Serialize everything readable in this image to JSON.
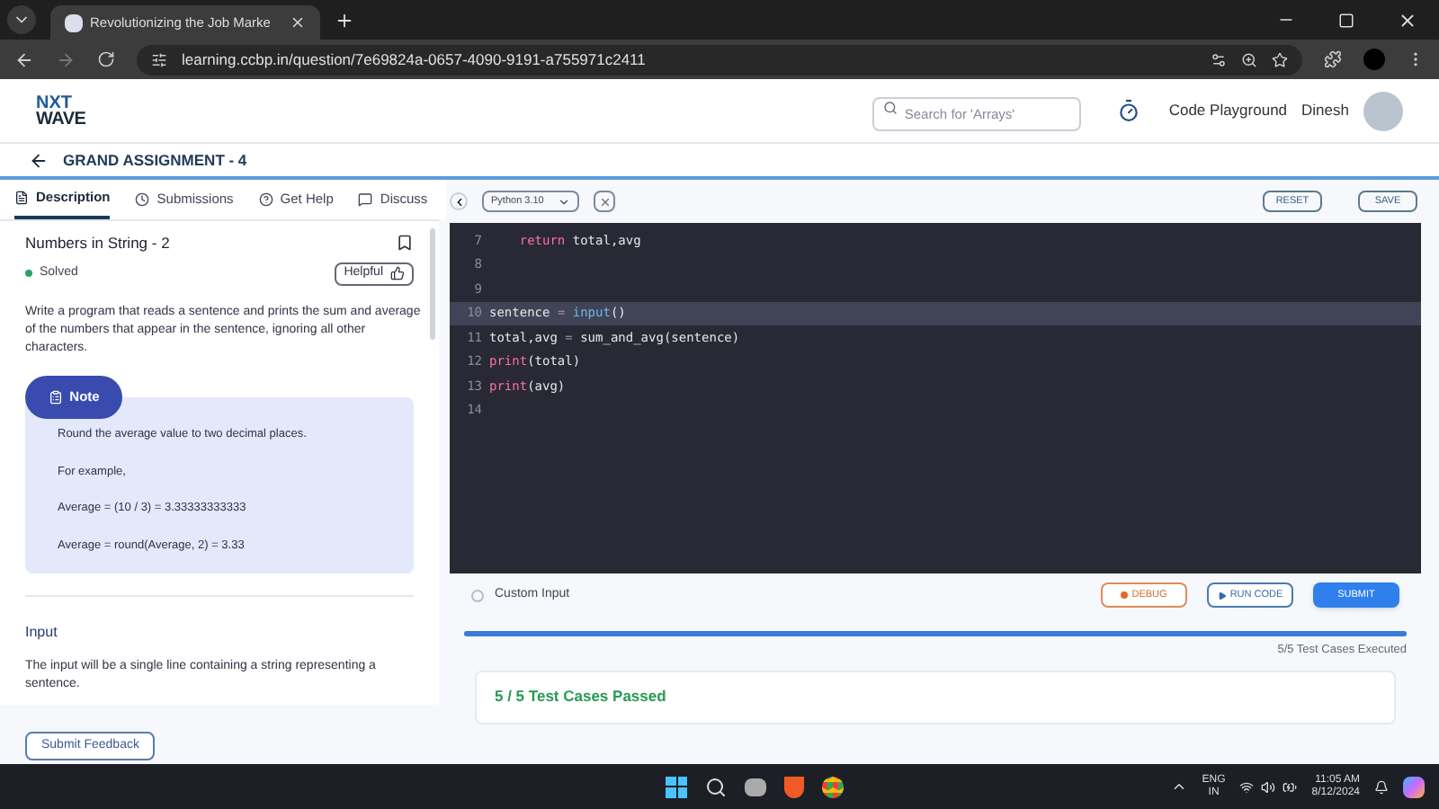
{
  "browser": {
    "tab_title": "Revolutionizing the Job Marke",
    "url": "learning.ccbp.in/question/7e69824a-0657-4090-9191-a755971c2411"
  },
  "header": {
    "logo_top": "NXT",
    "logo_bottom": "WAVE",
    "search": {
      "placeholder": "Search for 'Arrays'"
    },
    "links": [
      "Code Playground",
      "Dinesh"
    ]
  },
  "page_title": "GRAND ASSIGNMENT - 4",
  "tabs": [
    {
      "label": "Description",
      "selected": true
    },
    {
      "label": "Submissions",
      "selected": false
    },
    {
      "label": "Get Help",
      "selected": false
    },
    {
      "label": "Discuss",
      "selected": false
    }
  ],
  "question": {
    "title": "Numbers in String - 2",
    "status": "Solved",
    "helpful": "Helpful",
    "body": "Write a program that reads a sentence and prints the sum and average of the numbers that appear in the sentence, ignoring all other characters.",
    "note": {
      "label": "Note",
      "lines": [
        "Round the average value to two decimal places.",
        "For example,",
        "Average = (10 / 3) = 3.33333333333",
        "Average = round(Average, 2) = 3.33"
      ]
    },
    "input_heading": "Input",
    "input_text": "The input will be a single line containing a string representing a sentence."
  },
  "feedback_button": "Submit Feedback",
  "editor": {
    "language": "Python 3.10",
    "buttons": [
      "RESET",
      "SAVE"
    ],
    "lines": [
      {
        "number": "7",
        "highlighted": false,
        "tokens": [
          {
            "text": "    return",
            "kind": "keyword"
          },
          {
            "text": " total,avg",
            "kind": "plain"
          }
        ]
      },
      {
        "number": "8",
        "highlighted": false
      },
      {
        "number": "9",
        "highlighted": false
      },
      {
        "number": "10",
        "highlighted": true,
        "tokens": [
          {
            "text": "sentence ",
            "kind": "plain"
          },
          {
            "text": "= ",
            "kind": "operator"
          },
          {
            "text": "input",
            "kind": "builtin"
          },
          {
            "text": "()",
            "kind": "plain"
          }
        ]
      },
      {
        "number": "11",
        "highlighted": false,
        "tokens": [
          {
            "text": "total,avg ",
            "kind": "plain"
          },
          {
            "text": "=",
            "kind": "operator"
          },
          {
            "text": " sum_and_avg(sentence)",
            "kind": "plain"
          }
        ]
      },
      {
        "number": "12",
        "highlighted": false,
        "tokens": [
          {
            "text": "print",
            "kind": "keyword"
          },
          {
            "text": "(total)",
            "kind": "plain"
          }
        ]
      },
      {
        "number": "13",
        "highlighted": false,
        "tokens": [
          {
            "text": "print",
            "kind": "keyword"
          },
          {
            "text": "(avg)",
            "kind": "plain"
          }
        ]
      },
      {
        "number": "14",
        "highlighted": false
      }
    ]
  },
  "custom_input": {
    "label": "Custom Input",
    "checked": false
  },
  "actions": [
    {
      "label": "DEBUG",
      "kind": "debug"
    },
    {
      "label": "RUN CODE",
      "kind": "run"
    },
    {
      "label": "SUBMIT",
      "kind": "submit"
    }
  ],
  "progress": {
    "level": 1,
    "reading": "5/5 Test Cases Executed"
  },
  "result": "5 / 5 Test Cases Passed",
  "taskbar": {
    "language": "ENG",
    "region": "IN",
    "time": "11:05 AM",
    "date": "8/12/2024"
  }
}
